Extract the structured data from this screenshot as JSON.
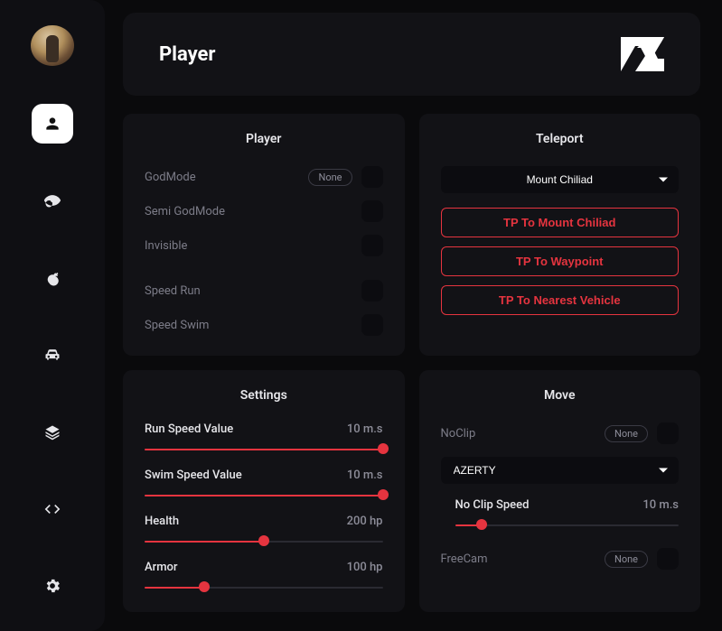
{
  "header": {
    "title": "Player"
  },
  "sidebar": {
    "active_index": 0
  },
  "panels": {
    "player": {
      "title": "Player",
      "items": [
        {
          "label": "GodMode",
          "badge": "None"
        },
        {
          "label": "Semi GodMode"
        },
        {
          "label": "Invisible"
        },
        {
          "label": "Speed Run"
        },
        {
          "label": "Speed Swim"
        }
      ]
    },
    "teleport": {
      "title": "Teleport",
      "select_value": "Mount Chiliad",
      "buttons": [
        "TP To  Mount Chiliad",
        "TP To Waypoint",
        "TP To Nearest Vehicle"
      ]
    },
    "settings": {
      "title": "Settings",
      "sliders": [
        {
          "label": "Run Speed Value",
          "value": "10 m.s",
          "pct": 100
        },
        {
          "label": "Swim Speed Value",
          "value": "10 m.s",
          "pct": 100
        },
        {
          "label": "Health",
          "value": "200 hp",
          "pct": 50
        },
        {
          "label": "Armor",
          "value": "100 hp",
          "pct": 25
        }
      ]
    },
    "move": {
      "title": "Move",
      "noclip": {
        "label": "NoClip",
        "badge": "None"
      },
      "layout_select": "AZERTY",
      "noclip_speed": {
        "label": "No Clip Speed",
        "value": "10 m.s",
        "pct": 12
      },
      "freecam": {
        "label": "FreeCam",
        "badge": "None"
      }
    }
  }
}
